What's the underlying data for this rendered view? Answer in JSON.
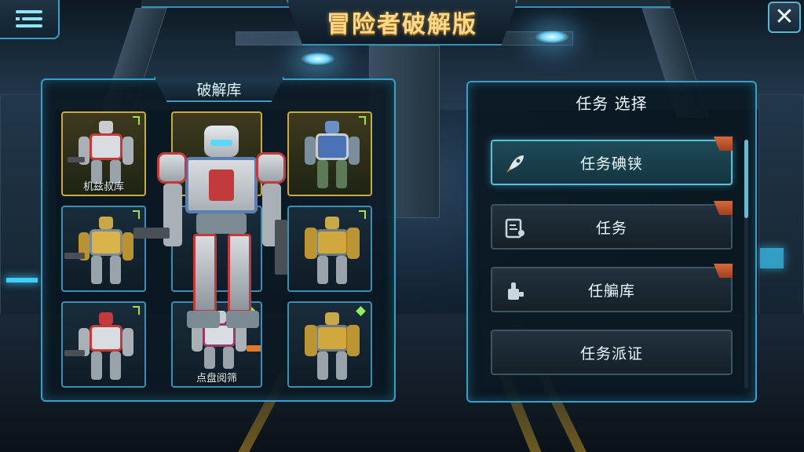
{
  "header": {
    "title": "冒险者破解版",
    "menu_icon": "menu-icon",
    "close_icon": "close-icon",
    "close_glyph": "✕"
  },
  "library": {
    "tab_label": "破解库",
    "cards": [
      {
        "label": "机兹叔库",
        "frame": "gold",
        "marker": "tag"
      },
      {
        "label": "",
        "frame": "gold",
        "marker": "tag"
      },
      {
        "label": "",
        "frame": "blue",
        "marker": "tag"
      },
      {
        "label": "",
        "frame": "blue",
        "marker": "tag"
      },
      {
        "label": "",
        "frame": "blue",
        "marker": "tag"
      },
      {
        "label": "点盘阅筛",
        "frame": "blue",
        "marker": "gem"
      },
      {
        "label": "",
        "frame": "blue",
        "marker": "gem"
      }
    ]
  },
  "missions": {
    "title": "任务 选择",
    "items": [
      {
        "label": "任务碘铗",
        "icon": "rocket-icon",
        "active": true,
        "badge": true
      },
      {
        "label": "任务",
        "icon": "document-icon",
        "active": false,
        "badge": true
      },
      {
        "label": "任艑库",
        "icon": "thumb-icon",
        "active": false,
        "badge": true
      },
      {
        "label": "任务派证",
        "icon": "",
        "active": false,
        "badge": false
      }
    ]
  },
  "colors": {
    "accent": "#3a9fc7",
    "title_gold": "#ffd98a",
    "frame_gold": "#c9a847",
    "badge_orange": "#d8683e"
  }
}
